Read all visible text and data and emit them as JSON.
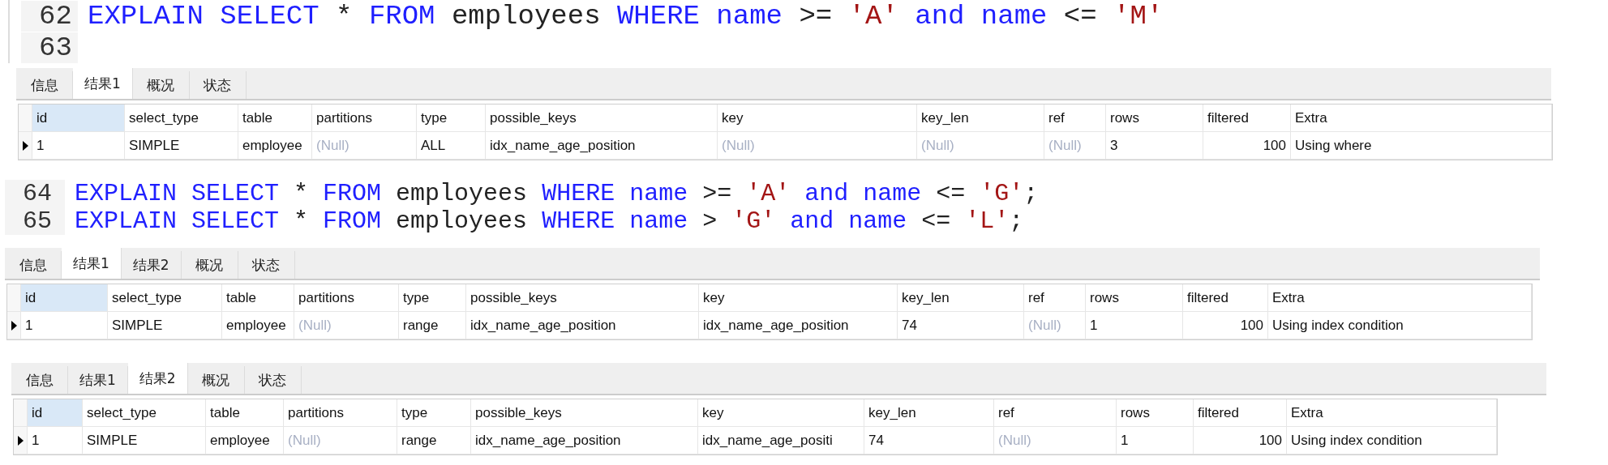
{
  "panels": [
    {
      "editor": {
        "lines": [
          {
            "number": "62",
            "tokens": [
              {
                "kind": "keyword",
                "text": "EXPLAIN SELECT"
              },
              {
                "kind": "plain",
                "text": " * "
              },
              {
                "kind": "keyword",
                "text": "FROM"
              },
              {
                "kind": "plain",
                "text": " employees "
              },
              {
                "kind": "keyword",
                "text": "WHERE name"
              },
              {
                "kind": "plain",
                "text": " >= "
              },
              {
                "kind": "string",
                "text": "'A'"
              },
              {
                "kind": "keyword",
                "text": " and name"
              },
              {
                "kind": "plain",
                "text": " <= "
              },
              {
                "kind": "string",
                "text": "'M'"
              }
            ]
          },
          {
            "number": "63"
          }
        ]
      },
      "tabs": [
        {
          "label": "信息",
          "selected": false
        },
        {
          "label": "结果1",
          "selected": true
        },
        {
          "label": "概况",
          "selected": false
        },
        {
          "label": "状态",
          "selected": false
        }
      ],
      "grid": {
        "columns": [
          "id",
          "select_type",
          "table",
          "partitions",
          "type",
          "possible_keys",
          "key",
          "key_len",
          "ref",
          "rows",
          "filtered",
          "Extra"
        ],
        "rows": [
          {
            "current": true,
            "cells": [
              {
                "kind": "text",
                "text": "1"
              },
              {
                "kind": "text",
                "text": "SIMPLE"
              },
              {
                "kind": "text",
                "text": "employee"
              },
              {
                "kind": "null",
                "text": "(Null)"
              },
              {
                "kind": "text",
                "text": "ALL"
              },
              {
                "kind": "text",
                "text": "idx_name_age_position"
              },
              {
                "kind": "null",
                "text": "(Null)"
              },
              {
                "kind": "null",
                "text": "(Null)"
              },
              {
                "kind": "null",
                "text": "(Null)"
              },
              {
                "kind": "text",
                "text": "3"
              },
              {
                "kind": "number",
                "text": "100"
              },
              {
                "kind": "text",
                "text": "Using where"
              }
            ]
          }
        ]
      }
    },
    {
      "editor": {
        "lines": [
          {
            "number": "64",
            "tokens": [
              {
                "kind": "keyword",
                "text": "EXPLAIN SELECT"
              },
              {
                "kind": "plain",
                "text": " * "
              },
              {
                "kind": "keyword",
                "text": "FROM"
              },
              {
                "kind": "plain",
                "text": " employees "
              },
              {
                "kind": "keyword",
                "text": "WHERE name"
              },
              {
                "kind": "plain",
                "text": " >= "
              },
              {
                "kind": "string",
                "text": "'A'"
              },
              {
                "kind": "keyword",
                "text": " and name"
              },
              {
                "kind": "plain",
                "text": " <= "
              },
              {
                "kind": "string",
                "text": "'G'"
              },
              {
                "kind": "plain",
                "text": ";"
              }
            ]
          },
          {
            "number": "65",
            "tokens": [
              {
                "kind": "keyword",
                "text": "EXPLAIN SELECT"
              },
              {
                "kind": "plain",
                "text": " * "
              },
              {
                "kind": "keyword",
                "text": "FROM"
              },
              {
                "kind": "plain",
                "text": " employees "
              },
              {
                "kind": "keyword",
                "text": "WHERE name"
              },
              {
                "kind": "plain",
                "text": " > "
              },
              {
                "kind": "string",
                "text": "'G'"
              },
              {
                "kind": "keyword",
                "text": " and name"
              },
              {
                "kind": "plain",
                "text": " <= "
              },
              {
                "kind": "string",
                "text": "'L'"
              },
              {
                "kind": "plain",
                "text": ";"
              }
            ]
          }
        ]
      },
      "tabs": [
        {
          "label": "信息",
          "selected": false
        },
        {
          "label": "结果1",
          "selected": true
        },
        {
          "label": "结果2",
          "selected": false
        },
        {
          "label": "概况",
          "selected": false
        },
        {
          "label": "状态",
          "selected": false
        }
      ],
      "grid": {
        "columns": [
          "id",
          "select_type",
          "table",
          "partitions",
          "type",
          "possible_keys",
          "key",
          "key_len",
          "ref",
          "rows",
          "filtered",
          "Extra"
        ],
        "rows": [
          {
            "current": true,
            "cells": [
              {
                "kind": "text",
                "text": "1"
              },
              {
                "kind": "text",
                "text": "SIMPLE"
              },
              {
                "kind": "text",
                "text": "employee"
              },
              {
                "kind": "null",
                "text": "(Null)"
              },
              {
                "kind": "text",
                "text": "range"
              },
              {
                "kind": "text",
                "text": "idx_name_age_position"
              },
              {
                "kind": "text",
                "text": "idx_name_age_position"
              },
              {
                "kind": "text",
                "text": "74"
              },
              {
                "kind": "null",
                "text": "(Null)"
              },
              {
                "kind": "text",
                "text": "1"
              },
              {
                "kind": "number",
                "text": "100"
              },
              {
                "kind": "text",
                "text": "Using index condition"
              }
            ]
          }
        ]
      }
    },
    {
      "tabs": [
        {
          "label": "信息",
          "selected": false
        },
        {
          "label": "结果1",
          "selected": false
        },
        {
          "label": "结果2",
          "selected": true
        },
        {
          "label": "概况",
          "selected": false
        },
        {
          "label": "状态",
          "selected": false
        }
      ],
      "grid": {
        "columns": [
          "id",
          "select_type",
          "table",
          "partitions",
          "type",
          "possible_keys",
          "key",
          "key_len",
          "ref",
          "rows",
          "filtered",
          "Extra"
        ],
        "rows": [
          {
            "current": true,
            "cells": [
              {
                "kind": "text",
                "text": "1"
              },
              {
                "kind": "text",
                "text": "SIMPLE"
              },
              {
                "kind": "text",
                "text": "employee"
              },
              {
                "kind": "null",
                "text": "(Null)"
              },
              {
                "kind": "text",
                "text": "range"
              },
              {
                "kind": "text",
                "text": "idx_name_age_position"
              },
              {
                "kind": "text",
                "text": "idx_name_age_positi"
              },
              {
                "kind": "text",
                "text": "74"
              },
              {
                "kind": "null",
                "text": "(Null)"
              },
              {
                "kind": "text",
                "text": "1"
              },
              {
                "kind": "number",
                "text": "100"
              },
              {
                "kind": "text",
                "text": "Using index condition"
              }
            ]
          }
        ]
      }
    }
  ]
}
